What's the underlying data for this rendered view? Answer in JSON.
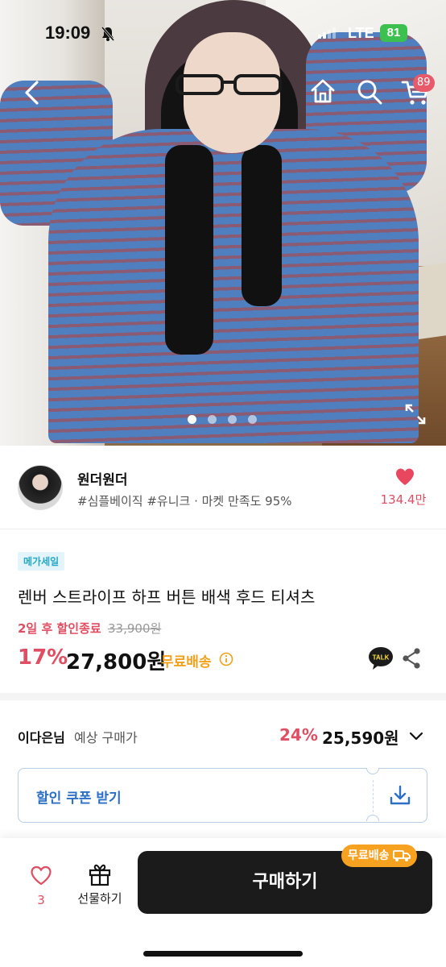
{
  "status_bar": {
    "time": "19:09",
    "network": "LTE",
    "battery": "81"
  },
  "header": {
    "cart_count": "89"
  },
  "gallery": {
    "total_images": 4,
    "active_index": 0
  },
  "shop": {
    "name": "원더원더",
    "tags": "#심플베이직 #유니크 · 마켓 만족도 95%",
    "like_count": "134.4만"
  },
  "product": {
    "badge": "메가세일",
    "title": "렌버 스트라이프 하프 버튼 배색 후드 티셔츠",
    "deadline": "2일 후 할인종료",
    "original_price": "33,900원",
    "discount": "17%",
    "price": "27,800원",
    "shipping": "무료배송"
  },
  "expected_price": {
    "user": "이다은님",
    "label": "예상 구매가",
    "discount": "24%",
    "price": "25,590원"
  },
  "coupon": {
    "label": "할인 쿠폰 받기"
  },
  "bottom_bar": {
    "wish_count": "3",
    "gift_label": "선물하기",
    "buy_label": "구매하기",
    "ship_badge": "무료배송"
  },
  "colors": {
    "accent_red": "#e04e63",
    "accent_blue": "#2d6fc4",
    "shipping_orange": "#f2a11c",
    "buy_button": "#1b1b1b"
  }
}
